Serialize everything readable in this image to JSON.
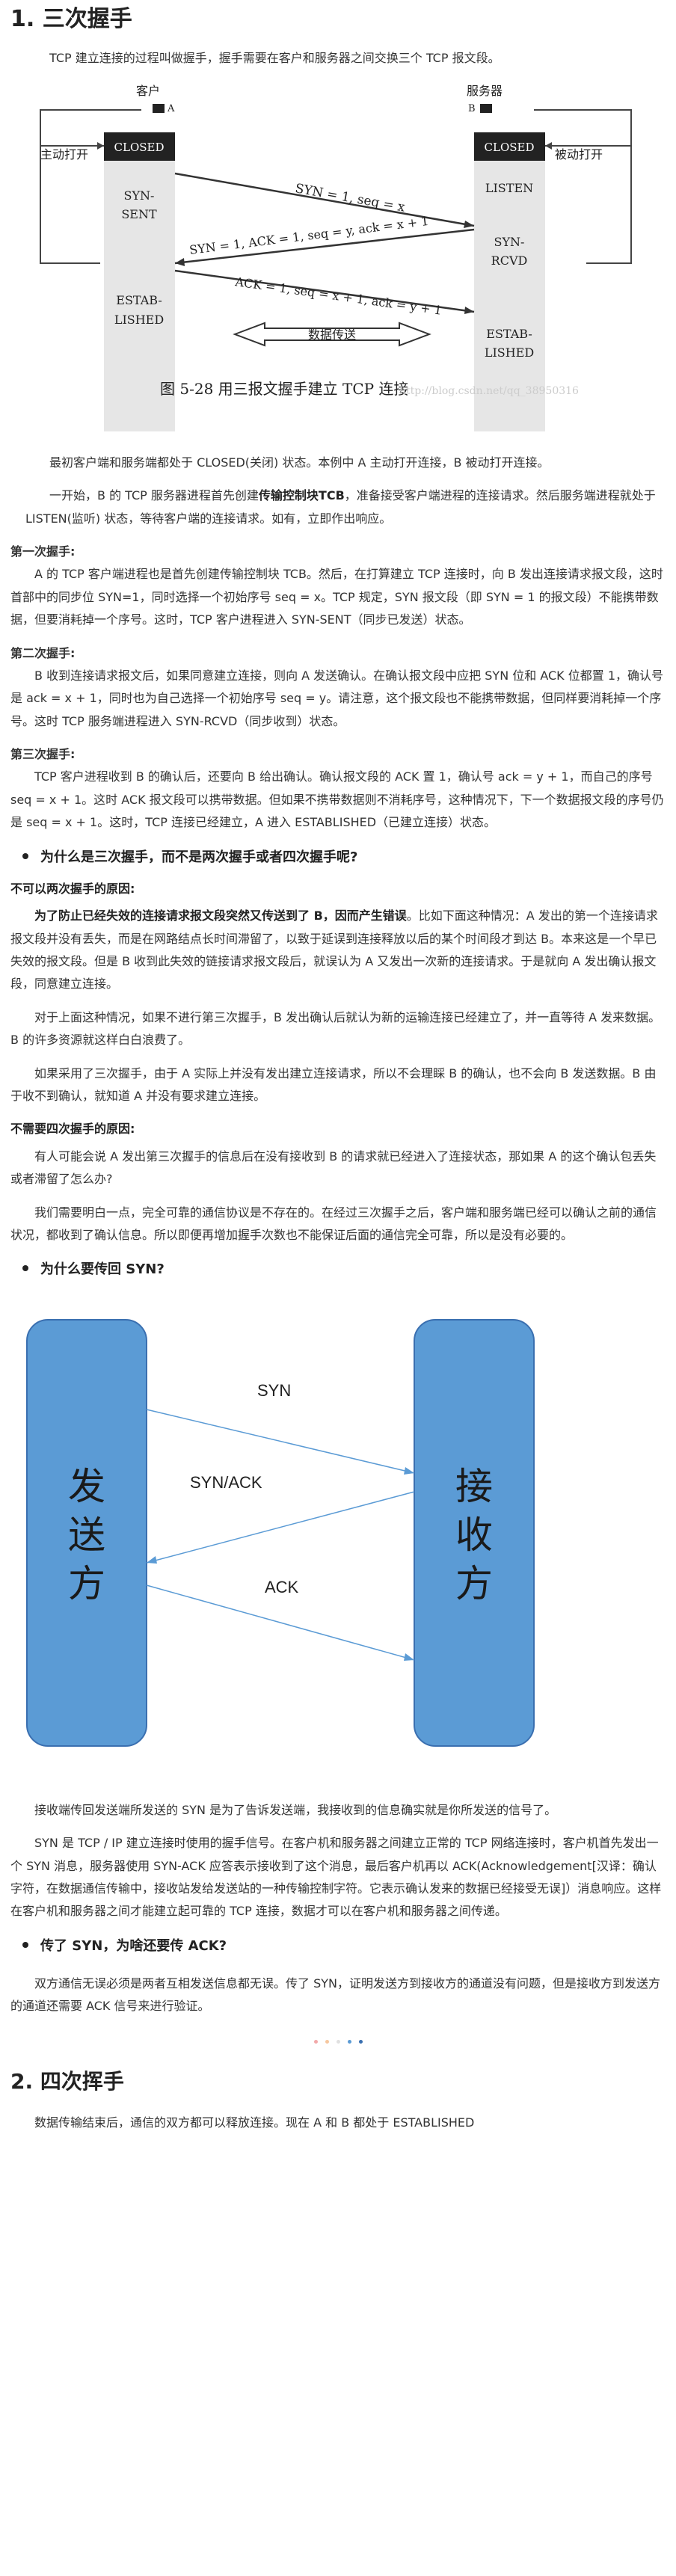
{
  "section1": {
    "title": "1. 三次握手"
  },
  "intro": "TCP 建立连接的过程叫做握手，握手需要在客户和服务器之间交换三个 TCP 报文段。",
  "fig1": {
    "client": "客户",
    "server": "服务器",
    "a": "A",
    "b": "B",
    "active_open": "主动打开",
    "passive_open": "被动打开",
    "closed": "CLOSED",
    "listen": "LISTEN",
    "syn_sent_1": "SYN-",
    "syn_sent_2": "SENT",
    "syn_rcvd_1": "SYN-",
    "syn_rcvd_2": "RCVD",
    "estab_a_1": "ESTAB-",
    "estab_a_2": "LISHED",
    "estab_b_1": "ESTAB-",
    "estab_b_2": "LISHED",
    "msg1": "SYN = 1, seq = x",
    "msg2": "SYN = 1, ACK = 1, seq = y, ack = x + 1",
    "msg3": "ACK = 1, seq = x + 1, ack = y + 1",
    "data_transfer": "数据传送",
    "caption": "图 5-28  用三报文握手建立 TCP 连接",
    "watermark": "http://blog.csdn.net/qq_38950316"
  },
  "p1": "最初客户端和服务端都处于 CLOSED(关闭) 状态。本例中 A 主动打开连接，B 被动打开连接。",
  "p2_pre": "一开始，B 的 TCP 服务器进程首先创建",
  "p2_bold": "传输控制块TCB",
  "p2_post": "，准备接受客户端进程的连接请求。然后服务端进程就处于 LISTEN(监听) 状态，等待客户端的连接请求。如有，立即作出响应。",
  "step1_title": "第一次握手:",
  "step1": "A 的 TCP 客户端进程也是首先创建传输控制块 TCB。然后，在打算建立 TCP 连接时，向 B 发出连接请求报文段，这时首部中的同步位 SYN=1，同时选择一个初始序号 seq = x。TCP 规定，SYN 报文段（即 SYN = 1 的报文段）不能携带数据，但要消耗掉一个序号。这时，TCP 客户进程进入 SYN-SENT（同步已发送）状态。",
  "step2_title": "第二次握手:",
  "step2": "B 收到连接请求报文后，如果同意建立连接，则向 A 发送确认。在确认报文段中应把 SYN 位和 ACK 位都置 1，确认号是 ack = x + 1，同时也为自己选择一个初始序号 seq = y。请注意，这个报文段也不能携带数据，但同样要消耗掉一个序号。这时 TCP 服务端进程进入 SYN-RCVD（同步收到）状态。",
  "step3_title": "第三次握手:",
  "step3": "TCP 客户进程收到 B 的确认后，还要向 B 给出确认。确认报文段的 ACK 置 1，确认号 ack = y + 1，而自己的序号 seq = x + 1。这时 ACK 报文段可以携带数据。但如果不携带数据则不消耗序号，这种情况下，下一个数据报文段的序号仍是 seq = x + 1。这时，TCP 连接已经建立，A 进入 ESTABLISHED（已建立连接）状态。",
  "q1": "为什么是三次握手，而不是两次握手或者四次握手呢?",
  "q1_sub": "不可以两次握手的原因:",
  "q1_p1_bold": "为了防止已经失效的连接请求报文段突然又传送到了 B，因而产生错误",
  "q1_p1_post": "。比如下面这种情况：A 发出的第一个连接请求报文段并没有丢失，而是在网路结点长时间滞留了，以致于延误到连接释放以后的某个时间段才到达 B。本来这是一个早已失效的报文段。但是 B 收到此失效的链接请求报文段后，就误认为 A 又发出一次新的连接请求。于是就向 A 发出确认报文段，同意建立连接。",
  "q1_p2": "对于上面这种情况，如果不进行第三次握手，B 发出确认后就认为新的运输连接已经建立了，并一直等待 A 发来数据。B 的许多资源就这样白白浪费了。",
  "q1_p3": "如果采用了三次握手，由于 A 实际上并没有发出建立连接请求，所以不会理睬 B 的确认，也不会向 B 发送数据。B 由于收不到确认，就知道 A 并没有要求建立连接。",
  "q1_sub2": "不需要四次握手的原因:",
  "q1_p4": "有人可能会说 A 发出第三次握手的信息后在没有接收到 B 的请求就已经进入了连接状态，那如果 A 的这个确认包丢失或者滞留了怎么办?",
  "q1_p5": "我们需要明白一点，完全可靠的通信协议是不存在的。在经过三次握手之后，客户端和服务端已经可以确认之前的通信状况，都收到了确认信息。所以即便再增加握手次数也不能保证后面的通信完全可靠，所以是没有必要的。",
  "q2": "为什么要传回 SYN?",
  "fig2": {
    "sender": [
      "发",
      "送",
      "方"
    ],
    "receiver": [
      "接",
      "收",
      "方"
    ],
    "syn": "SYN",
    "synack": "SYN/ACK",
    "ack": "ACK",
    "color": "#5b9bd5"
  },
  "q2_p1": "接收端传回发送端所发送的 SYN 是为了告诉发送端，我接收到的信息确实就是你所发送的信号了。",
  "q2_p2": "SYN 是 TCP / IP 建立连接时使用的握手信号。在客户机和服务器之间建立正常的 TCP 网络连接时，客户机首先发出一个 SYN 消息，服务器使用 SYN-ACK 应答表示接收到了这个消息，最后客户机再以 ACK(Acknowledgement[汉译：确认字符，在数据通信传输中，接收站发给发送站的一种传输控制字符。它表示确认发来的数据已经接受无误]）消息响应。这样在客户机和服务器之间才能建立起可靠的 TCP 连接，数据才可以在客户机和服务器之间传递。",
  "q3": "传了 SYN，为啥还要传 ACK?",
  "q3_p1": "双方通信无误必须是两者互相发送信息都无误。传了 SYN，证明发送方到接收方的通道没有问题，但是接收方到发送方的通道还需要 ACK 信号来进行验证。",
  "dots": [
    "#f2a9a9",
    "#f6c79f",
    "#e0e0e0",
    "#5b9bd5",
    "#3a6fb0"
  ],
  "section2": {
    "title": "2. 四次挥手"
  },
  "s2_p1": "数据传输结束后，通信的双方都可以释放连接。现在 A 和 B 都处于 ESTABLISHED"
}
